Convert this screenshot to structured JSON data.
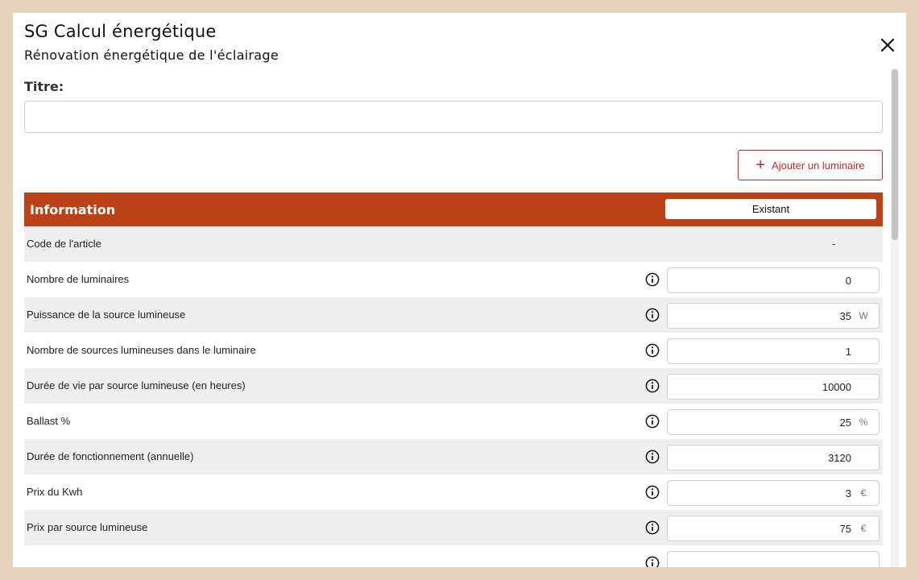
{
  "header": {
    "title": "SG Calcul énergétique",
    "subtitle": "Rénovation énergétique de l'éclairage"
  },
  "form": {
    "title_label": "Titre:",
    "title_value": ""
  },
  "toolbar": {
    "add_label": "Ajouter un luminaire"
  },
  "table": {
    "header_title": "Information",
    "column_label": "Existant",
    "rows": [
      {
        "label": "Code de l'article",
        "value": "-",
        "unit": ""
      },
      {
        "label": "Nombre de luminaires",
        "value": "0",
        "unit": ""
      },
      {
        "label": "Puissance de la source lumineuse",
        "value": "35",
        "unit": "W"
      },
      {
        "label": "Nombre de sources lumineuses dans le luminaire",
        "value": "1",
        "unit": ""
      },
      {
        "label": "Durée de vie par source lumineuse (en heures)",
        "value": "10000",
        "unit": ""
      },
      {
        "label": "Ballast %",
        "value": "25",
        "unit": "%"
      },
      {
        "label": "Durée de fonctionnement (annuelle)",
        "value": "3120",
        "unit": ""
      },
      {
        "label": "Prix du Kwh",
        "value": "3",
        "unit": "€"
      },
      {
        "label": "Prix par source lumineuse",
        "value": "75",
        "unit": "€"
      }
    ]
  },
  "icons": {
    "close": "close-icon",
    "add": "plus-icon",
    "info": "info-icon"
  },
  "colors": {
    "accent": "#bb4116",
    "button_border": "#c22a2a",
    "page_background": "#e6d3bd",
    "row_shade": "#efefef"
  }
}
